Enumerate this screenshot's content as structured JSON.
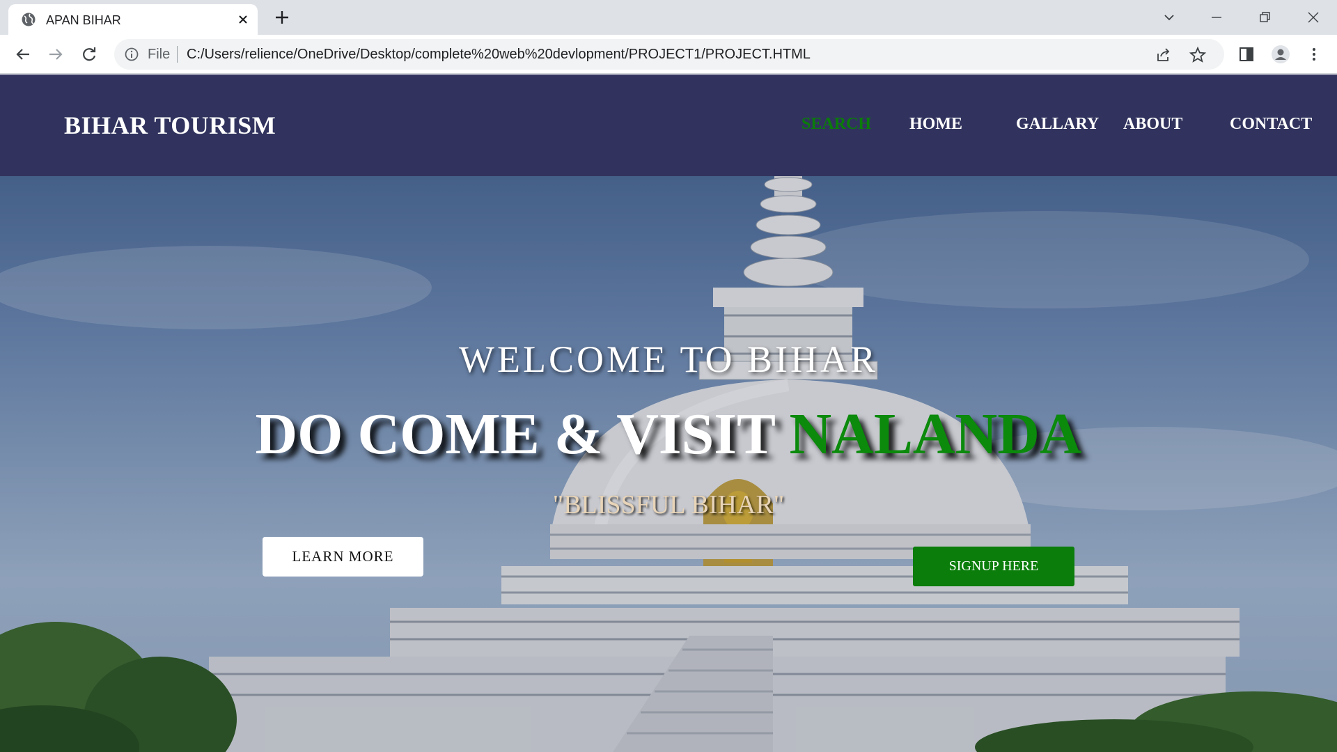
{
  "browser": {
    "tab": {
      "title": "APAN BIHAR"
    },
    "address_bar": {
      "scheme_label": "File",
      "url": "C:/Users/relience/OneDrive/Desktop/complete%20web%20devlopment/PROJECT1/PROJECT.HTML"
    },
    "icons": [
      "globe-icon",
      "close-icon",
      "plus-icon",
      "back-icon",
      "forward-icon",
      "reload-icon",
      "info-icon",
      "share-icon",
      "star-icon",
      "side-panel-icon",
      "profile-icon",
      "more-icon",
      "tab-search-icon",
      "minimize-icon",
      "restore-icon",
      "window-close-icon"
    ]
  },
  "site": {
    "brand": "BIHAR TOURISM",
    "nav": {
      "search": "SEARCH",
      "home": "HOME",
      "gallary": "GALLARY",
      "about": "ABOUT",
      "contact": "CONTACT"
    },
    "colors": {
      "header_bg": "#31335e",
      "accent_green": "#0a7d0a",
      "white": "#ffffff"
    }
  },
  "hero": {
    "welcome": "WELCOME TO BIHAR",
    "headline_main": "DO COME & VISIT ",
    "headline_accent": "NALANDA",
    "tagline": "\"BLISSFUL BIHAR\"",
    "learn_more": "LEARN MORE",
    "signup": "SIGNUP HERE"
  }
}
